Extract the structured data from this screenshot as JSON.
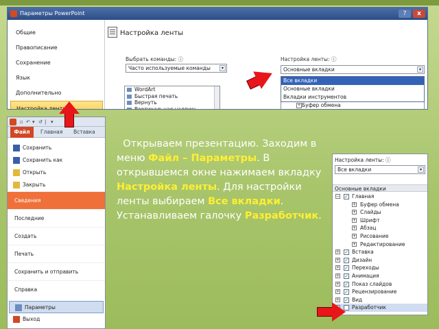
{
  "dialog": {
    "title": "Параметры PowerPoint",
    "help_btn": "?",
    "close_btn": "x",
    "sidebar": [
      "Общие",
      "Правописание",
      "Сохранение",
      "Язык",
      "Дополнительно",
      "Настройка ленты"
    ],
    "sidebar_selected": 5,
    "heading": "Настройка ленты",
    "choose_commands_label": "Выбрать команды:",
    "choose_commands_value": "Часто используемые команды",
    "customize_label": "Настройка ленты:",
    "customize_value": "Основные вкладки",
    "dropdown_options": [
      "Все вкладки",
      "Основные вкладки",
      "Вкладки инструментов"
    ],
    "dropdown_selected": 0,
    "commands": [
      "WordArt",
      "Быстрая печать",
      "Вернуть",
      "Вертикальная надпись"
    ],
    "tree_partial": [
      "Буфер обмена",
      "Слайды"
    ],
    "dropdown_arrow": "▾",
    "info_icon": "ⓘ"
  },
  "backstage": {
    "tabs": [
      "Файл",
      "Главная",
      "Вставка"
    ],
    "qat_glyphs": [
      "▫",
      "↶",
      "▾",
      "↺",
      "|",
      "▾"
    ],
    "small_items": [
      {
        "label": "Сохранить",
        "icon": "save-icon",
        "color": "#3a5fa8"
      },
      {
        "label": "Сохранить как",
        "icon": "save-as-icon",
        "color": "#3a5fa8"
      },
      {
        "label": "Открыть",
        "icon": "open-folder-icon",
        "color": "#e2b93b"
      },
      {
        "label": "Закрыть",
        "icon": "close-folder-icon",
        "color": "#e2b93b"
      }
    ],
    "big_items": [
      "Сведения",
      "Последние",
      "Создать",
      "Печать",
      "Сохранить и отправить",
      "Справка"
    ],
    "active_big": 0,
    "bottom_items": [
      {
        "label": "Параметры",
        "icon": "options-icon",
        "color": "#6c8dbd"
      },
      {
        "label": "Выход",
        "icon": "exit-icon",
        "color": "#d24726"
      }
    ],
    "highlight_bottom": 0
  },
  "description": {
    "p1": "Открываем презентацию. Заходим в меню ",
    "kw1": "Файл – Параметры",
    "p2": ". В открывшемся окне нажимаем вкладку ",
    "kw2": "Настройка ленты",
    "p3": ". Для настройки ленты выбираем ",
    "kw3": "Все вкладки",
    "p4": ". Устанавливаем галочку ",
    "kw4": "Разработчик",
    "p5": "."
  },
  "ribbon_tree": {
    "label": "Настройка ленты:",
    "dropdown_value": "Все вкладки",
    "group_header": "Основные вкладки",
    "expand_minus": "−",
    "expand_plus": "+",
    "check_mark": "✓",
    "rows": [
      {
        "label": "Главная",
        "level": 0,
        "expander": "minus",
        "checked": true
      },
      {
        "label": "Буфер обмена",
        "level": 1,
        "expander": "plus",
        "checked": false
      },
      {
        "label": "Слайды",
        "level": 1,
        "expander": "plus",
        "checked": false
      },
      {
        "label": "Шрифт",
        "level": 1,
        "expander": "plus",
        "checked": false
      },
      {
        "label": "Абзац",
        "level": 1,
        "expander": "plus",
        "checked": false
      },
      {
        "label": "Рисование",
        "level": 1,
        "expander": "plus",
        "checked": false
      },
      {
        "label": "Редактирование",
        "level": 1,
        "expander": "plus",
        "checked": false
      },
      {
        "label": "Вставка",
        "level": 0,
        "expander": "plus",
        "checked": true
      },
      {
        "label": "Дизайн",
        "level": 0,
        "expander": "plus",
        "checked": true
      },
      {
        "label": "Переходы",
        "level": 0,
        "expander": "plus",
        "checked": true
      },
      {
        "label": "Анимация",
        "level": 0,
        "expander": "plus",
        "checked": true
      },
      {
        "label": "Показ слайдов",
        "level": 0,
        "expander": "plus",
        "checked": true
      },
      {
        "label": "Рецензирование",
        "level": 0,
        "expander": "plus",
        "checked": true
      },
      {
        "label": "Вид",
        "level": 0,
        "expander": "plus",
        "checked": true
      },
      {
        "label": "Разработчик",
        "level": 0,
        "expander": "plus",
        "checked": false
      }
    ],
    "highlight_row": 14
  },
  "colors": {
    "slide_green": "#a9c56b",
    "keyword_yellow": "#ffef33",
    "arrow_red": "#e8161a",
    "file_tab": "#d24726"
  }
}
